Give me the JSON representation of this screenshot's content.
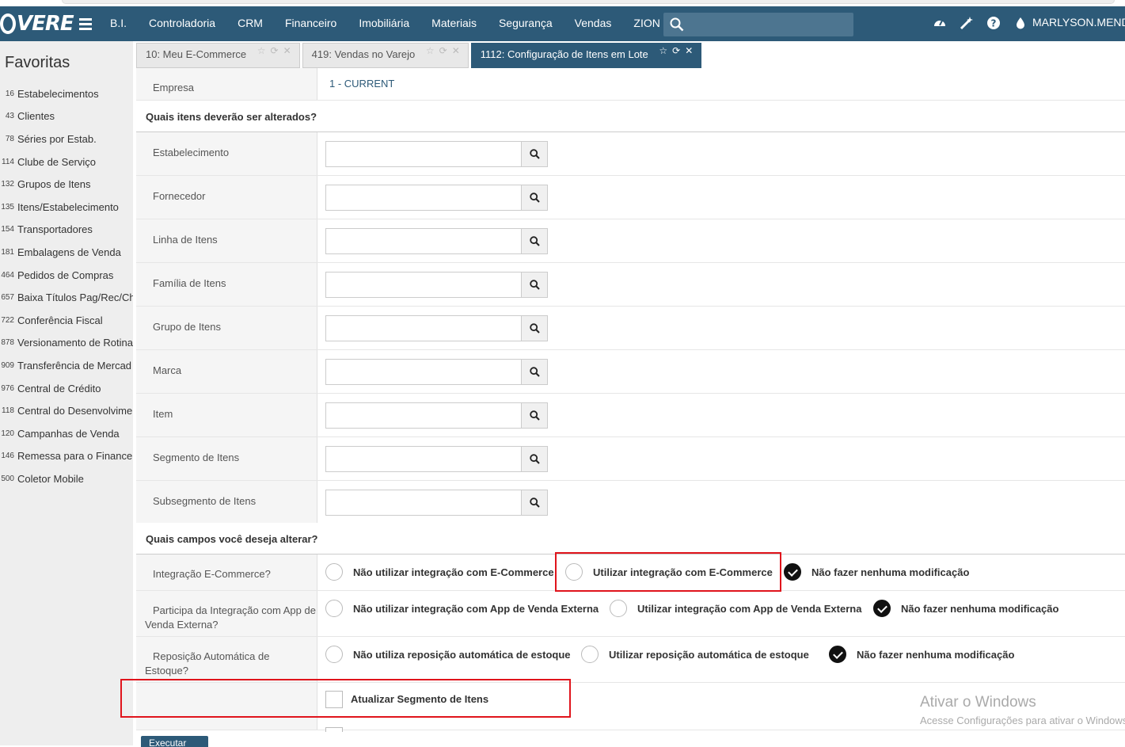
{
  "app": {
    "logo_text": "VERE",
    "user_name": "MARLYSON.MENDE"
  },
  "navbar": {
    "items": [
      "B.I.",
      "Controladoria",
      "CRM",
      "Financeiro",
      "Imobiliária",
      "Materiais",
      "Segurança",
      "Vendas",
      "ZION"
    ],
    "search_placeholder": "",
    "icons": [
      "dashboard-icon",
      "magic-wand-icon",
      "help-icon",
      "theme-drop-icon"
    ]
  },
  "sidebar": {
    "title": "Favoritas",
    "items": [
      {
        "code": "16",
        "label": "Estabelecimentos"
      },
      {
        "code": "43",
        "label": "Clientes"
      },
      {
        "code": "78",
        "label": "Séries por Estab."
      },
      {
        "code": "114",
        "label": "Clube de Serviço"
      },
      {
        "code": "132",
        "label": "Grupos de Itens"
      },
      {
        "code": "135",
        "label": "Itens/Estabelecimento"
      },
      {
        "code": "154",
        "label": "Transportadores"
      },
      {
        "code": "181",
        "label": "Embalagens de Venda"
      },
      {
        "code": "464",
        "label": "Pedidos de Compras"
      },
      {
        "code": "657",
        "label": "Baixa Títulos Pag/Rec/Ch"
      },
      {
        "code": "722",
        "label": "Conferência Fiscal"
      },
      {
        "code": "878",
        "label": "Versionamento de Rotina"
      },
      {
        "code": "909",
        "label": "Transferência de Mercad"
      },
      {
        "code": "976",
        "label": "Central de Crédito"
      },
      {
        "code": "118",
        "label": "Central do Desenvolvime"
      },
      {
        "code": "120",
        "label": "Campanhas de Venda"
      },
      {
        "code": "146",
        "label": "Remessa para o Finance"
      },
      {
        "code": "500",
        "label": "Coletor Mobile"
      }
    ]
  },
  "tabs": [
    {
      "label": "10: Meu E-Commerce",
      "active": false
    },
    {
      "label": "419: Vendas no Varejo",
      "active": false
    },
    {
      "label": "1112: Configuração de Itens em Lote",
      "active": true
    }
  ],
  "form": {
    "empresa_label": "Empresa",
    "empresa_value": "1 - CURRENT",
    "section_items": "Quais itens deverão ser alterados?",
    "filters": [
      {
        "label": "Estabelecimento",
        "value": ""
      },
      {
        "label": "Fornecedor",
        "value": ""
      },
      {
        "label": "Linha de Itens",
        "value": ""
      },
      {
        "label": "Família de Itens",
        "value": ""
      },
      {
        "label": "Grupo de Itens",
        "value": ""
      },
      {
        "label": "Marca",
        "value": ""
      },
      {
        "label": "Item",
        "value": ""
      },
      {
        "label": "Segmento de Itens",
        "value": ""
      },
      {
        "label": "Subsegmento de Itens",
        "value": ""
      }
    ],
    "section_fields": "Quais campos você deseja alterar?",
    "integracao_ecommerce": {
      "label": "Integração E-Commerce?",
      "options": [
        "Não utilizar integração com E-Commerce",
        "Utilizar integração com E-Commerce",
        "Não fazer nenhuma modificação"
      ],
      "selected": 2
    },
    "integracao_app": {
      "label_line1": "Participa da Integração com App de",
      "label_line2": "Venda Externa?",
      "options": [
        "Não utilizar integração com App de Venda Externa",
        "Utilizar integração com App de Venda Externa",
        "Não fazer nenhuma modificação"
      ],
      "selected": 2
    },
    "reposicao": {
      "label_line1": "Reposição Automática de",
      "label_line2": "Estoque?",
      "options": [
        "Não utiliza reposição automática de estoque",
        "Utilizar reposição automática de estoque",
        "Não fazer nenhuma modificação"
      ],
      "selected": 2
    },
    "atualizar_segmento": {
      "label": "Atualizar Segmento de Itens",
      "checked": false
    },
    "execute_label": "Executar"
  },
  "watermark": {
    "line1": "Ativar o Windows",
    "line2": "Acesse Configurações para ativar o Windows."
  },
  "colors": {
    "navbar": "#2d5a78",
    "highlight": "#e0141c"
  }
}
